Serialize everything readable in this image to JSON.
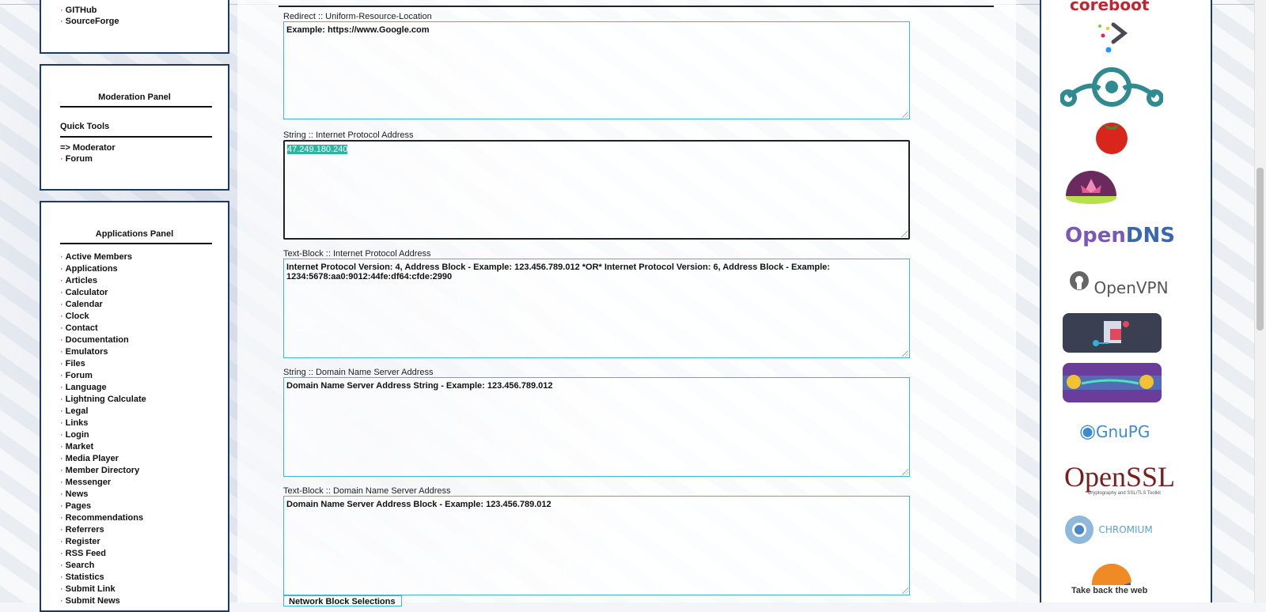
{
  "left": {
    "top_links": [
      "GITHub",
      "SourceForge"
    ],
    "moderation": {
      "title": "Moderation Panel",
      "quick_tools": "Quick Tools",
      "items": [
        "=> Moderator",
        "Forum"
      ]
    },
    "applications": {
      "title": "Applications Panel",
      "items": [
        "Active Members",
        "Applications",
        "Articles",
        "Calculator",
        "Calendar",
        "Clock",
        "Contact",
        "Documentation",
        "Emulators",
        "Files",
        "Forum",
        "Language",
        "Lightning Calculate",
        "Legal",
        "Links",
        "Login",
        "Market",
        "Media Player",
        "Member Directory",
        "Messenger",
        "News",
        "Pages",
        "Recommendations",
        "Referrers",
        "Register",
        "RSS Feed",
        "Search",
        "Statistics",
        "Submit Link",
        "Submit News"
      ]
    }
  },
  "fields": [
    {
      "label": "Redirect :: Uniform-Resource-Location",
      "value": "Example: https://www.Google.com"
    },
    {
      "label": "String :: Internet Protocol Address",
      "value": "47.249.180.240"
    },
    {
      "label": "Text-Block :: Internet Protocol Address",
      "value": "Internet Protocol Version: 4, Address Block - Example: 123.456.789.012 *OR* Internet Protocol Version: 6, Address Block - Example: 1234:5678:aa0:9012:44fe:df64:cfde:2990"
    },
    {
      "label": "String :: Domain Name Server Address",
      "value": "Domain Name Server Address String - Example: 123.456.789.012"
    },
    {
      "label": "Text-Block :: Domain Name Server Address",
      "value": "Domain Name Server Address Block - Example: 123.456.789.012"
    }
  ],
  "network_button": "Network Block Selections",
  "right": {
    "logos": {
      "coreboot": "coreboot",
      "opendns_open": "Open",
      "opendns_dns": "DNS",
      "openvpn": "OpenVPN",
      "gnupg": "GnuPG",
      "openssl": "OpenSSL",
      "openssl_tag": "Cryptography and SSL/TLS Toolkit",
      "chromium": "CHROMIUM",
      "firefox_tag": "Take back the web"
    },
    "colors": {
      "opendns_open": "#7b57b8",
      "opendns_dns": "#3a66b0",
      "openssl": "#7a1d1d",
      "chromium": "#5aa0d8"
    }
  }
}
